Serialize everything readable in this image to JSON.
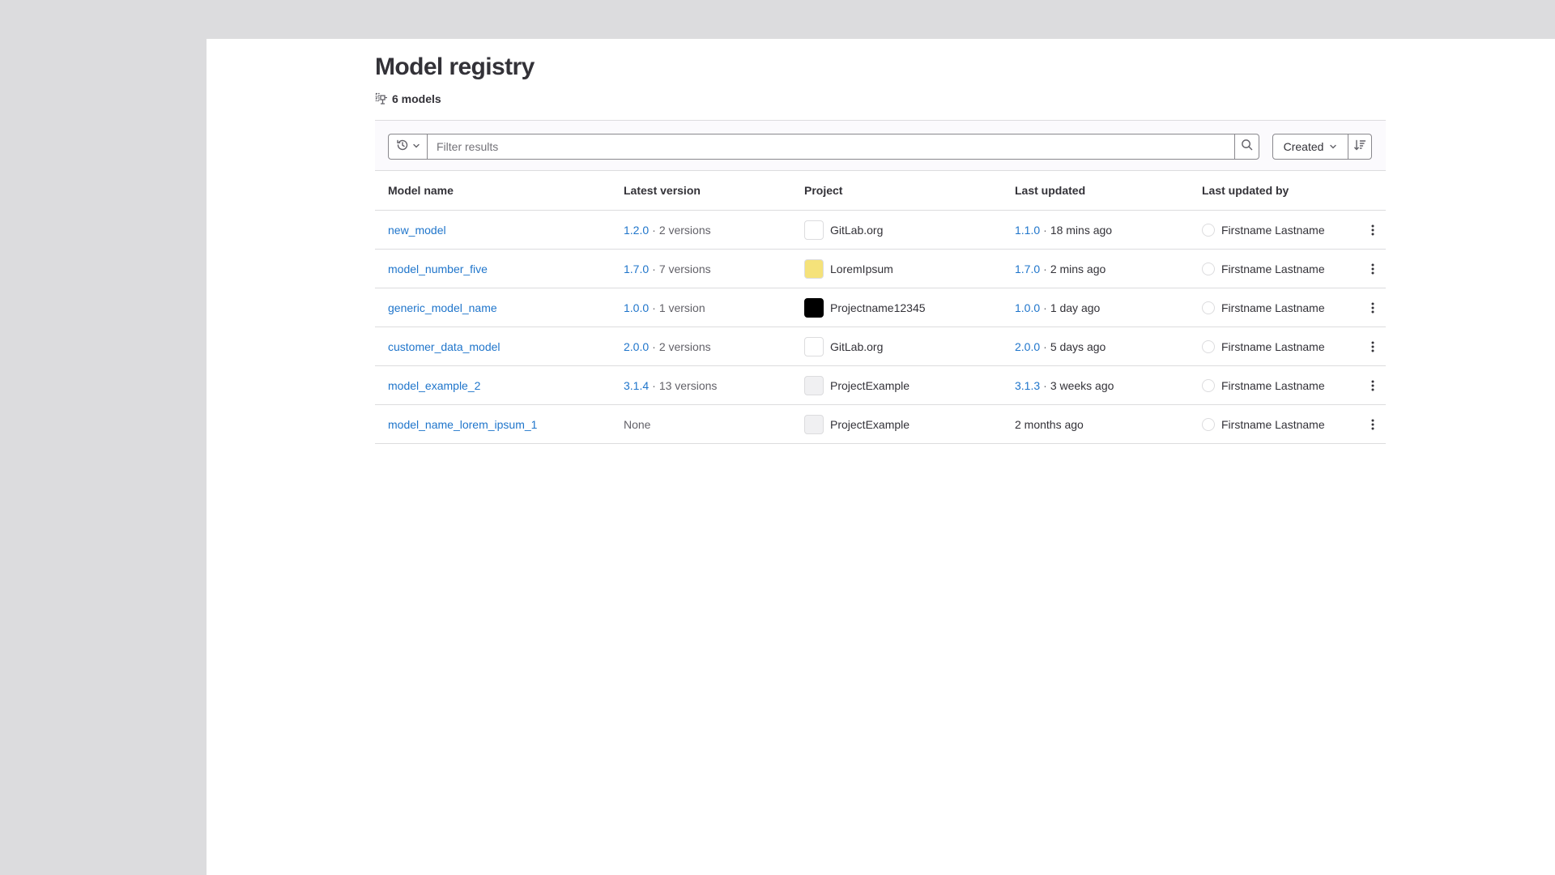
{
  "page": {
    "title": "Model registry",
    "count_label": "6 models"
  },
  "filter": {
    "placeholder": "Filter results",
    "sort_label": "Created"
  },
  "table": {
    "headers": [
      "Model name",
      "Latest version",
      "Project",
      "Last updated",
      "Last updated by"
    ],
    "rows": [
      {
        "name": "new_model",
        "version": "1.2.0",
        "versions_count": "2 versions",
        "project": "GitLab.org",
        "project_color": "#ffffff",
        "updated_version": "1.1.0",
        "updated_ago": "18 mins ago",
        "updated_by": "Firstname Lastname"
      },
      {
        "name": "model_number_five",
        "version": "1.7.0",
        "versions_count": "7 versions",
        "project": "LoremIpsum",
        "project_color": "#f5e27a",
        "updated_version": "1.7.0",
        "updated_ago": "2 mins ago",
        "updated_by": "Firstname Lastname"
      },
      {
        "name": "generic_model_name",
        "version": "1.0.0",
        "versions_count": "1 version",
        "project": "Projectname12345",
        "project_color": "#000000",
        "updated_version": "1.0.0",
        "updated_ago": "1 day ago",
        "updated_by": "Firstname Lastname"
      },
      {
        "name": "customer_data_model",
        "version": "2.0.0",
        "versions_count": "2 versions",
        "project": "GitLab.org",
        "project_color": "#ffffff",
        "updated_version": "2.0.0",
        "updated_ago": "5 days ago",
        "updated_by": "Firstname Lastname"
      },
      {
        "name": "model_example_2",
        "version": "3.1.4",
        "versions_count": "13 versions",
        "project": "ProjectExample",
        "project_color": "#f0f0f2",
        "updated_version": "3.1.3",
        "updated_ago": "3 weeks ago",
        "updated_by": "Firstname Lastname"
      },
      {
        "name": "model_name_lorem_ipsum_1",
        "version": "None",
        "versions_count": "",
        "project": "ProjectExample",
        "project_color": "#f0f0f2",
        "updated_version": "",
        "updated_ago": "2 months ago",
        "updated_by": "Firstname Lastname"
      }
    ]
  },
  "icons": {
    "count": "model-icon",
    "history": "history-icon",
    "search": "search-icon",
    "sort_direction": "sort-lowest-icon",
    "actions": "ellipsis-v-icon"
  },
  "colors": {
    "link": "#1f75cb",
    "text": "#333238",
    "muted": "#626168",
    "border": "#dcdcde",
    "canvas": "#dcdcde"
  }
}
